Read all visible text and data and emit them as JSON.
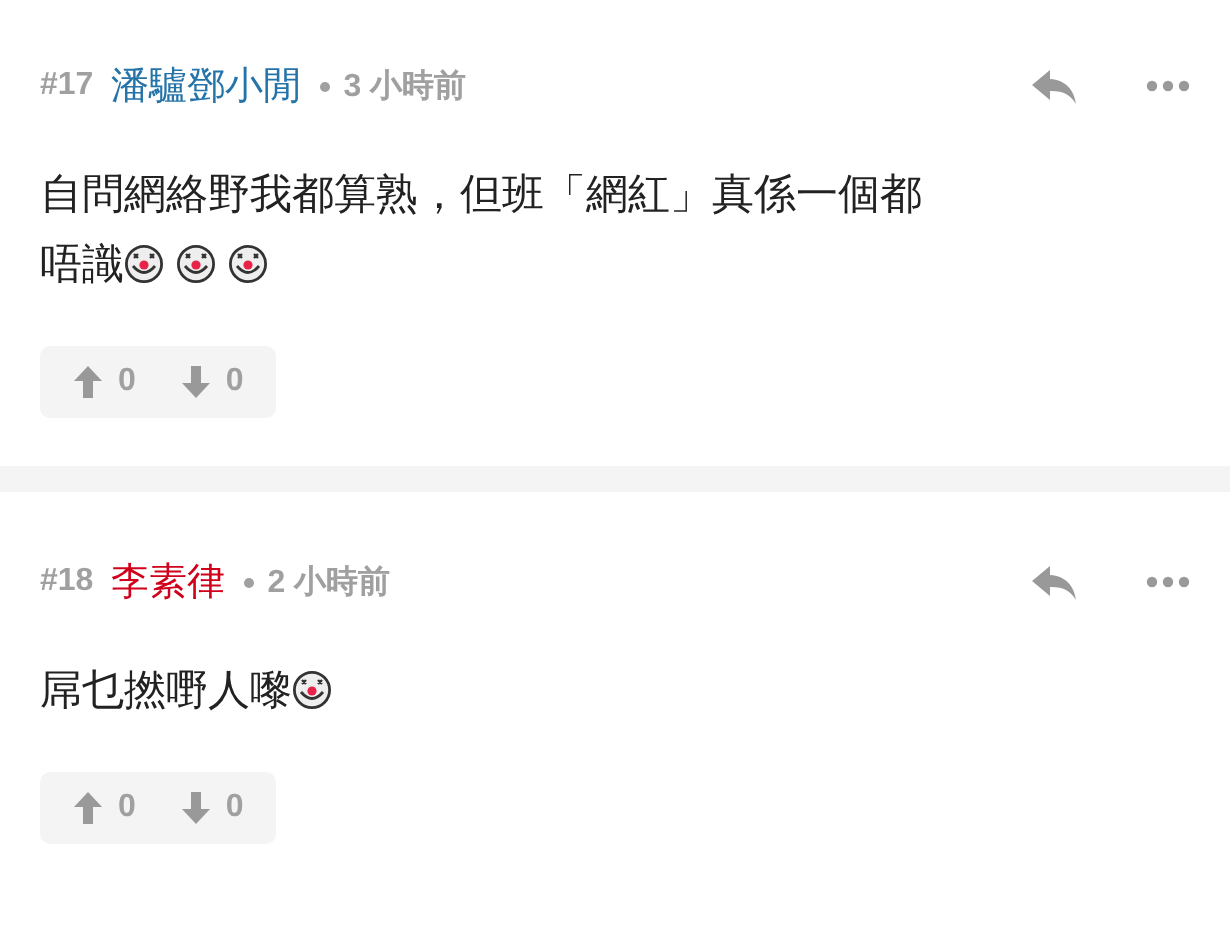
{
  "comments": [
    {
      "number": "#17",
      "author": "潘驢鄧小閒",
      "color": "#2574a9",
      "time": "3 小時前",
      "content": [
        {
          "kind": "line",
          "text": "自問網絡野我都算熟，但班「網紅」真係一個都"
        },
        {
          "kind": "text",
          "text": "唔識"
        },
        {
          "kind": "emoji"
        },
        {
          "kind": "emoji"
        },
        {
          "kind": "emoji"
        }
      ],
      "upvotes": "0",
      "downvotes": "0"
    },
    {
      "number": "#18",
      "author": "李素律",
      "color": "#d0021b",
      "time": "2 小時前",
      "content": [
        {
          "kind": "text",
          "text": "屌乜撚嘢人嚟"
        },
        {
          "kind": "emoji"
        }
      ],
      "upvotes": "0",
      "downvotes": "0"
    }
  ]
}
